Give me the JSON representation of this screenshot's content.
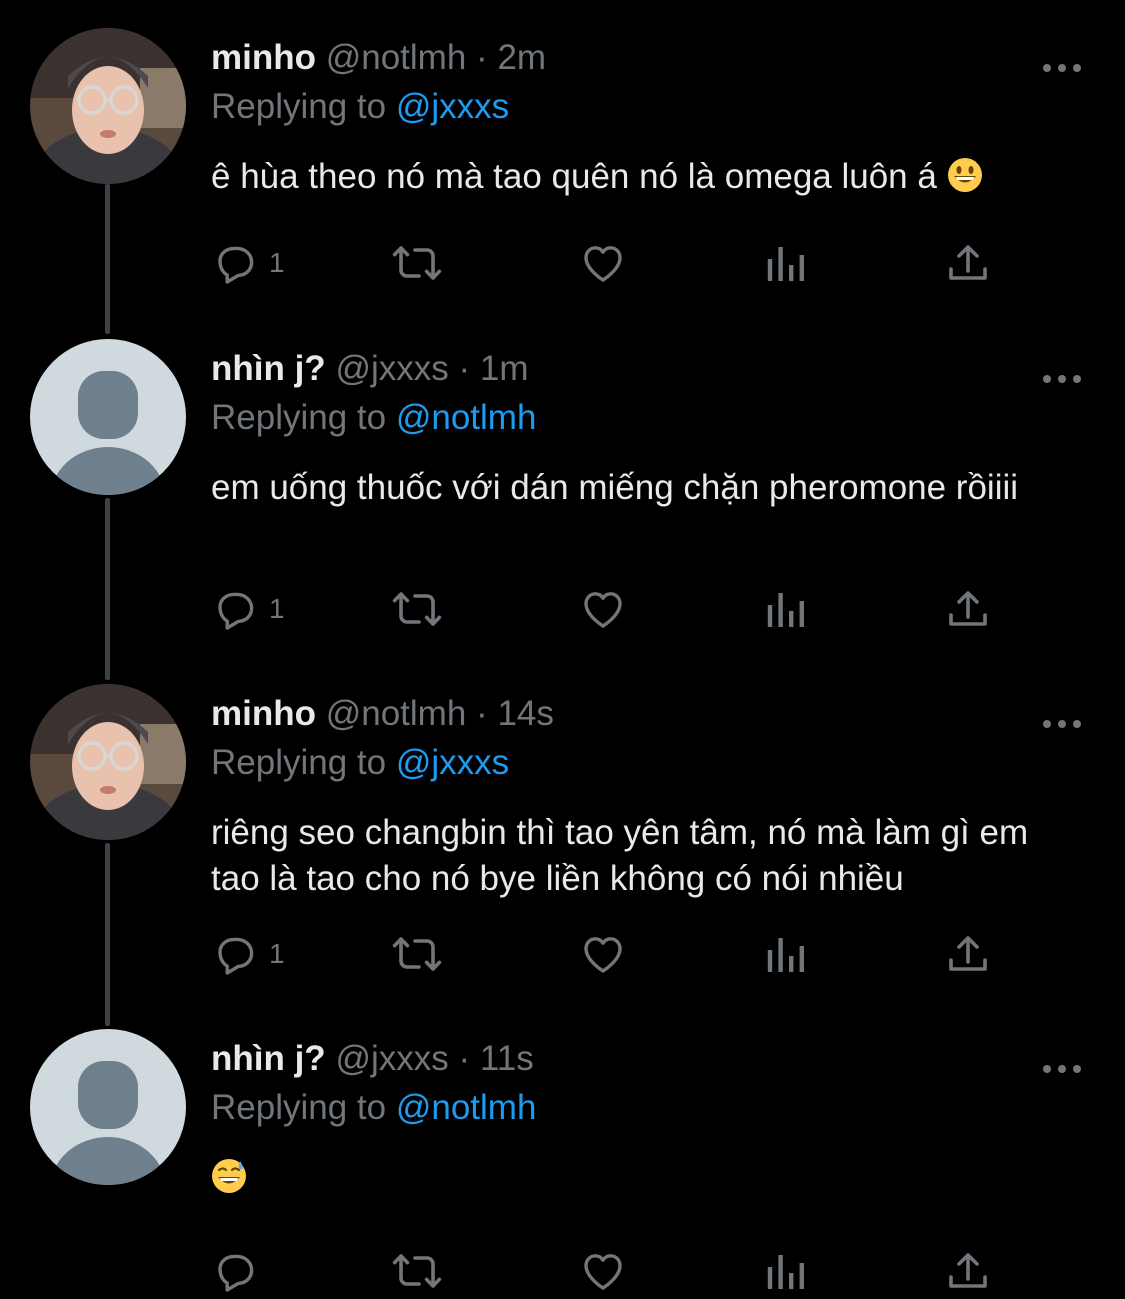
{
  "colors": {
    "background": "#000000",
    "text": "#e7e9ea",
    "muted": "#71767b",
    "link": "#1d9bf0",
    "thread_line": "#3e4144",
    "default_avatar_bg": "#cfd9de",
    "default_avatar_fg": "#6e7f8d"
  },
  "labels": {
    "replying_to": "Replying to",
    "separator": "·"
  },
  "tweets": [
    {
      "avatar": "photo-avatar",
      "name": "minho",
      "handle": "@notlmh",
      "time": "2m",
      "reply_to": "@jxxxs",
      "text": "ê hùa theo nó mà tao quên nó là omega luôn á",
      "emoji": "grinning-face",
      "reply_count": "1"
    },
    {
      "avatar": "default-avatar",
      "name": "nhìn j?",
      "handle": "@jxxxs",
      "time": "1m",
      "reply_to": "@notlmh",
      "text": "em uống thuốc với dán miếng chặn pheromone rồiiii",
      "emoji": "",
      "reply_count": "1"
    },
    {
      "avatar": "photo-avatar",
      "name": "minho",
      "handle": "@notlmh",
      "time": "14s",
      "reply_to": "@jxxxs",
      "text": "riêng seo changbin thì tao yên tâm, nó mà làm gì em tao là tao cho nó bye liền không có nói nhiều",
      "emoji": "",
      "reply_count": "1"
    },
    {
      "avatar": "default-avatar",
      "name": "nhìn j?",
      "handle": "@jxxxs",
      "time": "11s",
      "reply_to": "@notlmh",
      "text": "",
      "emoji": "grinning-face-with-sweat",
      "reply_count": ""
    }
  ],
  "icons": {
    "more": "more-icon",
    "reply": "reply-icon",
    "retweet": "retweet-icon",
    "like": "heart-icon",
    "views": "views-icon",
    "share": "share-icon"
  }
}
